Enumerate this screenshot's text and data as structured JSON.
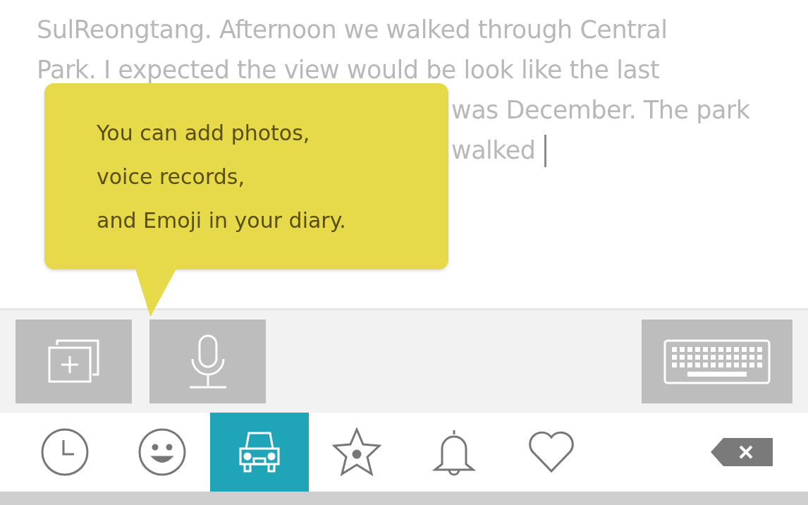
{
  "diary": {
    "lines": [
      {
        "text": "SulReongtang. Afternoon we walked through Central",
        "indent": false
      },
      {
        "text": "Park. I expected the view would be look like the last",
        "indent": false
      },
      {
        "text": "was December. The park",
        "indent": true
      },
      {
        "text": "walked",
        "indent": true
      }
    ],
    "cursor": true
  },
  "tooltip": {
    "text": "You can add photos,\nvoice records,\nand Emoji in your diary."
  },
  "attach_buttons": [
    {
      "kind": "photo"
    },
    {
      "kind": "voice"
    }
  ],
  "keyboard_button": {
    "kind": "keyboard"
  },
  "emoji_tabs": [
    {
      "kind": "clock",
      "selected": false
    },
    {
      "kind": "smiley",
      "selected": false
    },
    {
      "kind": "car",
      "selected": true
    },
    {
      "kind": "star",
      "selected": false
    },
    {
      "kind": "bell",
      "selected": false
    },
    {
      "kind": "heart",
      "selected": false
    }
  ],
  "backspace": {
    "kind": "backspace"
  }
}
